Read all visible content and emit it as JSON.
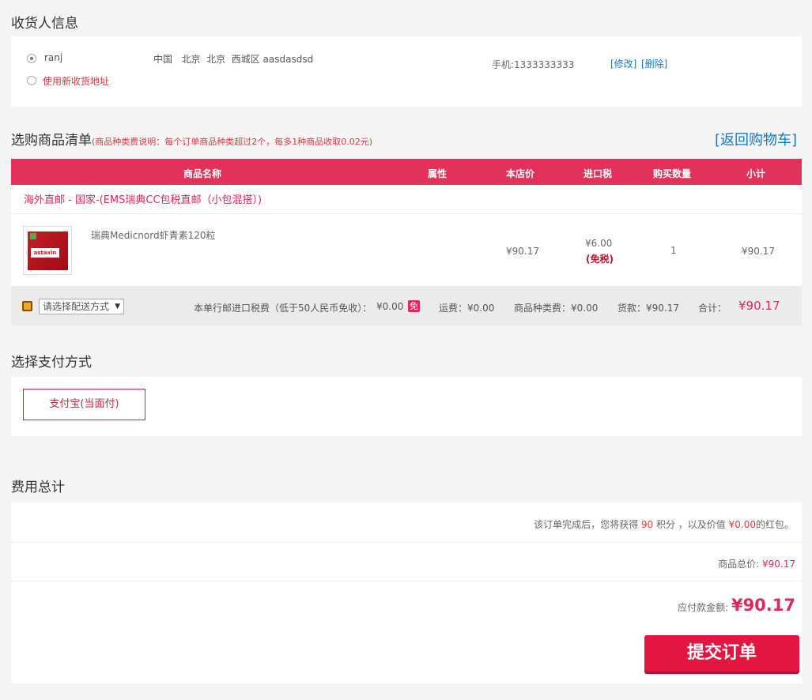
{
  "receiver": {
    "title": "收货人信息",
    "name": "ranj",
    "address": "中国   北京  北京  西城区 aasdasdsd",
    "phone": "手机:1333333333",
    "edit": "[修改]",
    "delete": "[删除]",
    "new_address": "使用新收货地址"
  },
  "goods": {
    "title": "选购商品清单",
    "note": "(商品种类费说明：每个订单商品种类超过2个，每多1种商品收取0.02元)",
    "back_link": "[返回购物车]",
    "columns": [
      "商品名称",
      "属性",
      "本店价",
      "进口税",
      "购买数量",
      "小计"
    ],
    "group": "海外直邮 - 国家-(EMS瑞典CC包税直邮（小包混搭）)",
    "item": {
      "name": "瑞典Medicnord虾青素120粒",
      "image_text": "astaxin",
      "price": "¥90.17",
      "tax": "¥6.00",
      "tax_note": "(免税)",
      "qty": "1",
      "subtotal": "¥90.17"
    },
    "summary": {
      "delivery_placeholder": "请选择配送方式",
      "tax_label": "本单行邮进口税费（低于50人民币免收）：",
      "tax_value": "¥0.00",
      "tax_badge": "免",
      "shipping": "运费：¥0.00",
      "kind_fee": "商品种类费：¥0.00",
      "goods_amount": "货款：¥90.17",
      "total_label": "合计：",
      "total_value": "¥90.17"
    }
  },
  "payment": {
    "title": "选择支付方式",
    "option": "支付宝(当面付)"
  },
  "fees": {
    "title": "费用总计",
    "points_pre": "该订单完成后，您将获得 ",
    "points": "90",
    "points_mid": " 积分 ，以及价值 ",
    "bonus": "¥0.00",
    "points_post": "的红包。",
    "goods_total_label": "商品总价: ",
    "goods_total": "¥90.17",
    "payable_label": "应付款金额: ",
    "payable": "¥90.17",
    "submit": "提交订单"
  }
}
